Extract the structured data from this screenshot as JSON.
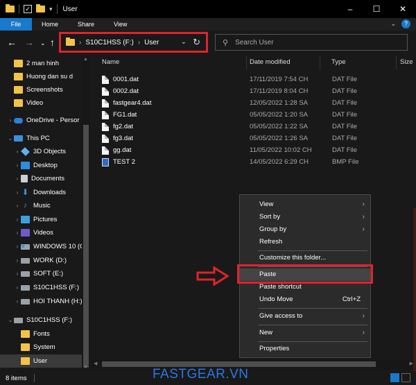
{
  "window": {
    "title": "User",
    "controls": [
      "–",
      "☐",
      "✕"
    ]
  },
  "ribbon": {
    "tabs": [
      "File",
      "Home",
      "Share",
      "View"
    ]
  },
  "address": {
    "drive": "S10C1HSS (F:)",
    "folder": "User"
  },
  "search": {
    "placeholder": "Search User"
  },
  "sidebar": {
    "items": [
      {
        "label": "2 man hinh",
        "icon": "folder-icon"
      },
      {
        "label": "Huong dan su d",
        "icon": "folder-icon"
      },
      {
        "label": "Screenshots",
        "icon": "folder-icon"
      },
      {
        "label": "Video",
        "icon": "folder-icon"
      },
      {
        "label": "OneDrive - Persor",
        "icon": "cloud-icon"
      },
      {
        "label": "This PC",
        "icon": "pc-icon"
      },
      {
        "label": "3D Objects",
        "icon": "cube-icon"
      },
      {
        "label": "Desktop",
        "icon": "desktop-icon"
      },
      {
        "label": "Documents",
        "icon": "documents-icon"
      },
      {
        "label": "Downloads",
        "icon": "download-icon"
      },
      {
        "label": "Music",
        "icon": "music-icon"
      },
      {
        "label": "Pictures",
        "icon": "pictures-icon"
      },
      {
        "label": "Videos",
        "icon": "videos-icon"
      },
      {
        "label": "WINDOWS 10 (C",
        "icon": "drive-icon"
      },
      {
        "label": "WORK (D:)",
        "icon": "drive-icon"
      },
      {
        "label": "SOFT (E:)",
        "icon": "drive-icon"
      },
      {
        "label": "S10C1HSS (F:)",
        "icon": "drive-icon"
      },
      {
        "label": "HOI THANH (H:)",
        "icon": "drive-icon"
      },
      {
        "label": "S10C1HSS (F:)",
        "icon": "drive-icon"
      },
      {
        "label": "Fonts",
        "icon": "folder-icon"
      },
      {
        "label": "System",
        "icon": "folder-icon"
      },
      {
        "label": "User",
        "icon": "folder-icon"
      }
    ]
  },
  "columns": {
    "name": "Name",
    "date": "Date modified",
    "type": "Type",
    "size": "Size"
  },
  "files": [
    {
      "name": "0001.dat",
      "date": "17/11/2019 7:54 CH",
      "type": "DAT File"
    },
    {
      "name": "0002.dat",
      "date": "17/11/2019 8:04 CH",
      "type": "DAT File"
    },
    {
      "name": "fastgear4.dat",
      "date": "12/05/2022 1:28 SA",
      "type": "DAT File"
    },
    {
      "name": "FG1.dat",
      "date": "05/05/2022 1:20 SA",
      "type": "DAT File"
    },
    {
      "name": "fg2.dat",
      "date": "05/05/2022 1:22 SA",
      "type": "DAT File"
    },
    {
      "name": "fg3.dat",
      "date": "05/05/2022 1:26 SA",
      "type": "DAT File"
    },
    {
      "name": "gg.dat",
      "date": "11/05/2022 10:02 CH",
      "type": "DAT File"
    },
    {
      "name": "TEST 2",
      "date": "14/05/2022 6:29 CH",
      "type": "BMP File"
    }
  ],
  "context_menu": {
    "view": "View",
    "sort_by": "Sort by",
    "group_by": "Group by",
    "refresh": "Refresh",
    "customize": "Customize this folder...",
    "paste": "Paste",
    "paste_shortcut": "Paste shortcut",
    "undo_move": "Undo Move",
    "undo_shortcut": "Ctrl+Z",
    "give_access": "Give access to",
    "new": "New",
    "properties": "Properties"
  },
  "status": {
    "count": "8 items"
  },
  "watermark": "FASTGEAR.VN",
  "colors": {
    "highlight_red": "#e0232b",
    "accent_blue": "#1979ca",
    "background": "#191919"
  }
}
